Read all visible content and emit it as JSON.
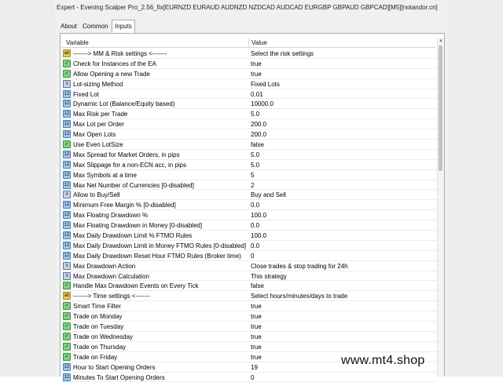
{
  "window": {
    "title": "Expert - Evening Scalper Pro_2.56_fix[EURNZD EURAUD AUDNZD NZDCAD AUDCAD EURGBP GBPAUD GBPCAD][M5][notandor.cn]"
  },
  "tabs": [
    {
      "label": "About"
    },
    {
      "label": "Common"
    },
    {
      "label": "Inputs",
      "active": true
    }
  ],
  "table": {
    "columns": [
      "Variable",
      "Value"
    ],
    "rows": [
      {
        "type": "ab",
        "name": "-------> MM & Risk settings <-------",
        "value": "Select the risk settings"
      },
      {
        "type": "bool",
        "name": "Check for Instances of the EA",
        "value": "true"
      },
      {
        "type": "bool",
        "name": "Allow Opening a new Trade",
        "value": "true"
      },
      {
        "type": "enum",
        "name": "Lot-sizing Method",
        "value": "Fixed Lots"
      },
      {
        "type": "num",
        "name": "Fixed Lot",
        "value": "0.01"
      },
      {
        "type": "num",
        "name": "Dynamic Lot (Balance/Equity based)",
        "value": "10000.0"
      },
      {
        "type": "num",
        "name": "Max Risk per Trade",
        "value": "5.0"
      },
      {
        "type": "num",
        "name": "Max Lot per Order",
        "value": "200.0"
      },
      {
        "type": "num",
        "name": "Max Open Lots",
        "value": "200.0"
      },
      {
        "type": "bool",
        "name": "Use Even LotSize",
        "value": "false"
      },
      {
        "type": "num",
        "name": "Max Spread for Market Orders, in pips",
        "value": "5.0"
      },
      {
        "type": "num",
        "name": "Max Slippage for a non-ECN acc, in pips",
        "value": "5.0"
      },
      {
        "type": "num",
        "name": "Max Symbols at a time",
        "value": "5"
      },
      {
        "type": "num",
        "name": "Max Net Number of Currencies [0-disabled]",
        "value": "2"
      },
      {
        "type": "enum",
        "name": "Allow to Buy/Sell",
        "value": "Buy and Sell"
      },
      {
        "type": "num",
        "name": "Minimum Free Margin % [0-disabled]",
        "value": "0.0"
      },
      {
        "type": "num",
        "name": "Max Floating Drawdown %",
        "value": "100.0"
      },
      {
        "type": "num",
        "name": "Max Floating Drawdown in Money [0-disabled]",
        "value": "0.0"
      },
      {
        "type": "num",
        "name": "Max Daily Drawdown Limit % FTMO Rules",
        "value": "100.0"
      },
      {
        "type": "num",
        "name": "Max Daily Drawdown Limit in Money FTMO Rules [0-disabled]",
        "value": "0.0"
      },
      {
        "type": "num",
        "name": "Max Daily Drawdown Reset Hour FTMO Rules (Broker time)",
        "value": "0"
      },
      {
        "type": "enum",
        "name": "Max Drawdown Action",
        "value": "Close trades & stop trading for 24h"
      },
      {
        "type": "enum",
        "name": "Max Drawdown Calculation",
        "value": "This strategy"
      },
      {
        "type": "bool",
        "name": "Handle Max Drawdown Events on Every Tick",
        "value": "false"
      },
      {
        "type": "ab",
        "name": "-------> Time settings <-------",
        "value": "Select hours/minutes/days to trade"
      },
      {
        "type": "bool",
        "name": "Smart Time Filter",
        "value": "true"
      },
      {
        "type": "bool",
        "name": "Trade on Monday",
        "value": "true"
      },
      {
        "type": "bool",
        "name": "Trade on Tuesday",
        "value": "true"
      },
      {
        "type": "bool",
        "name": "Trade on Wednesday",
        "value": "true"
      },
      {
        "type": "bool",
        "name": "Trade on Thursday",
        "value": "true"
      },
      {
        "type": "bool",
        "name": "Trade on Friday",
        "value": "true"
      },
      {
        "type": "num",
        "name": "Hour to Start Opening Orders",
        "value": "19"
      },
      {
        "type": "num",
        "name": "Minutes To Start Opening Orders",
        "value": "0"
      }
    ]
  },
  "icons": {
    "ab": "ab-string-icon",
    "bool": "bool-icon",
    "num": "number-icon",
    "enum": "enum-icon"
  },
  "watermark": "www.mt4.shop"
}
